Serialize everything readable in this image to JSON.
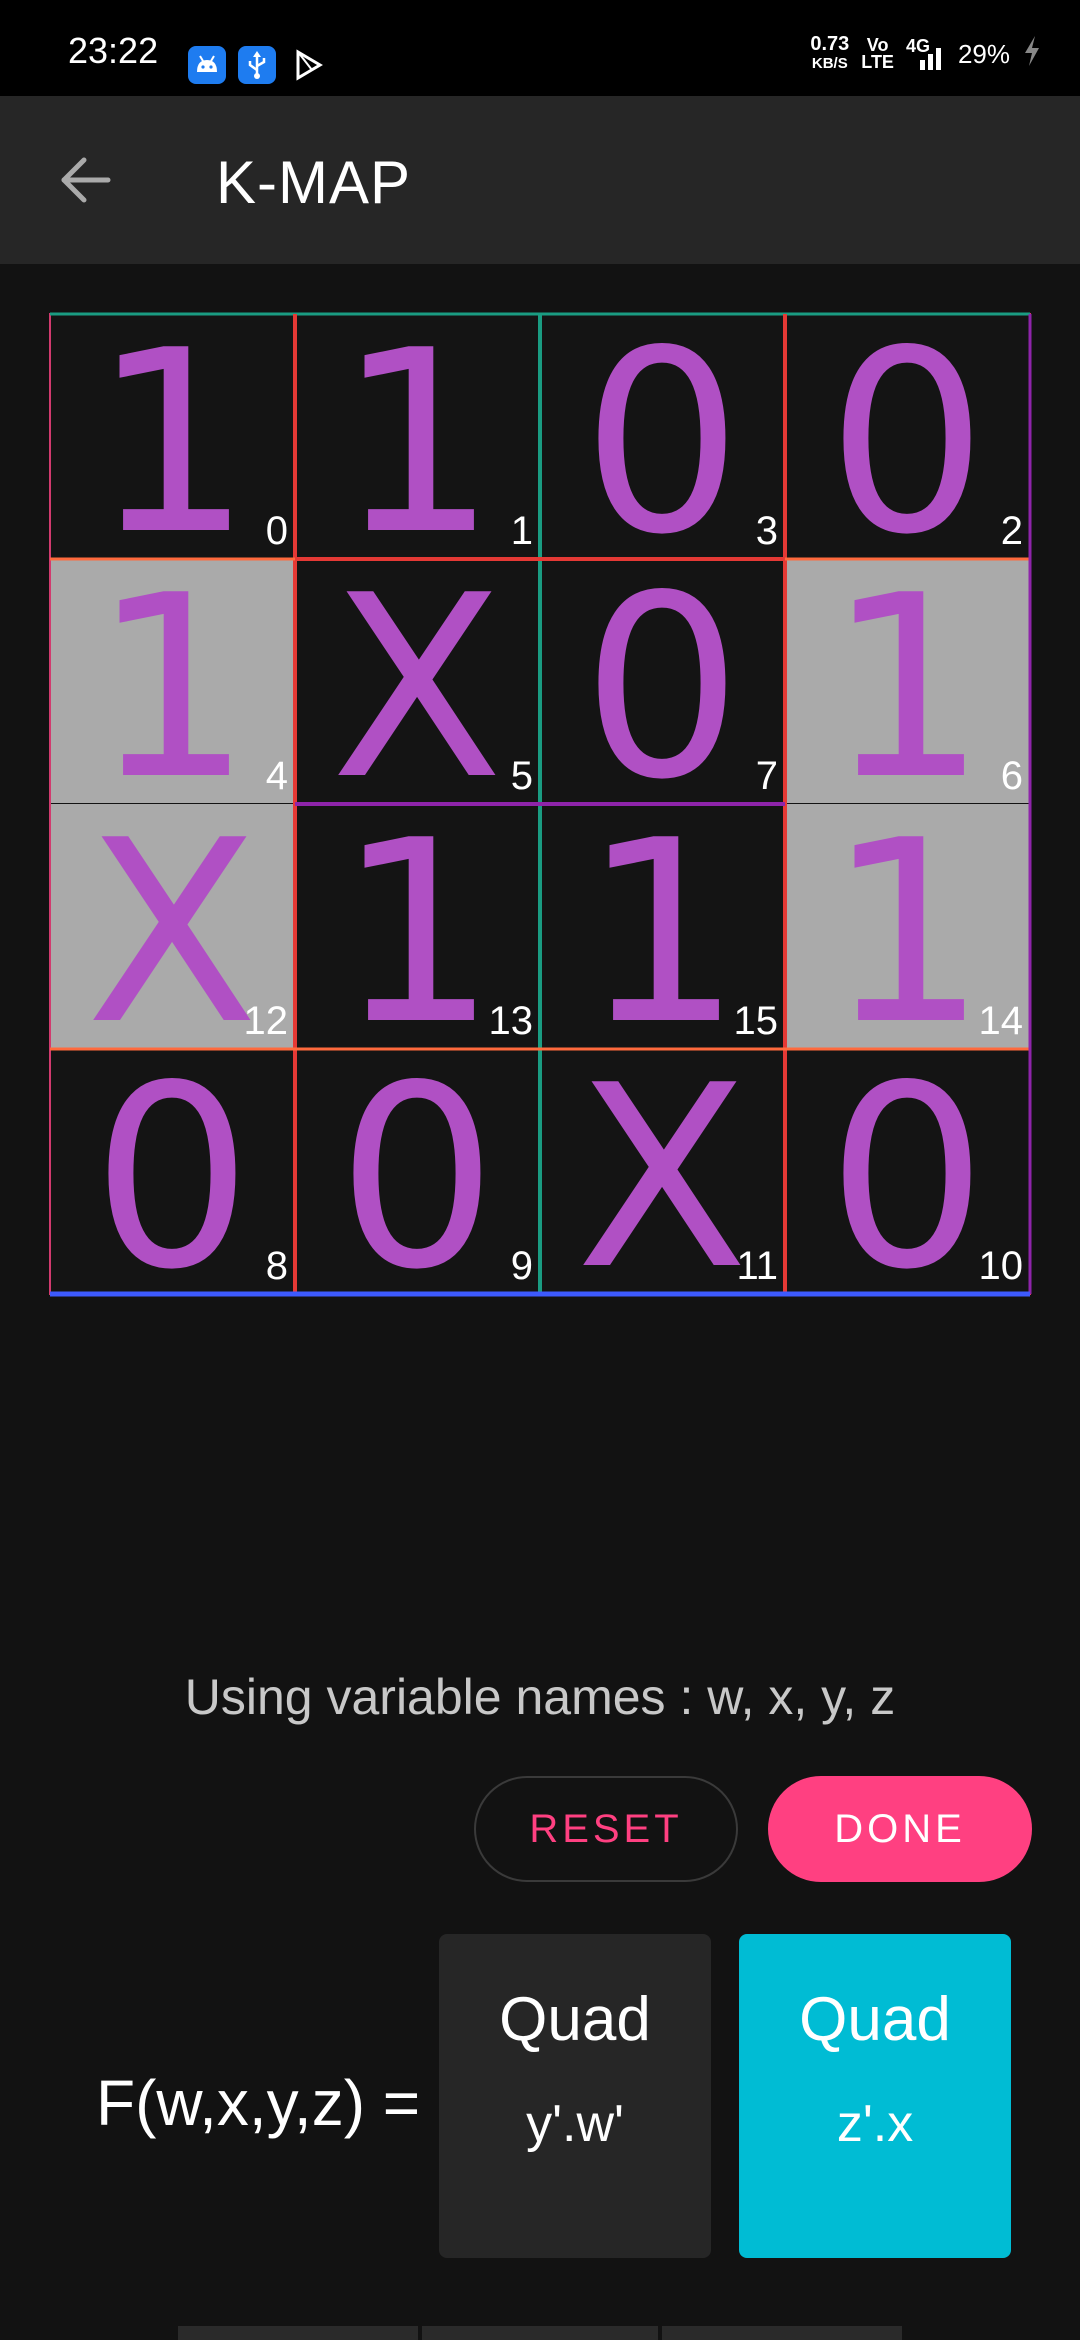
{
  "status_bar": {
    "time": "23:22",
    "speed_value": "0.73",
    "speed_unit": "KB/S",
    "volte_top": "Vo",
    "volte_bottom": "LTE",
    "network": "4G",
    "battery": "29%",
    "icons": [
      "android-icon",
      "usb-icon",
      "play-store-icon",
      "charging-icon"
    ]
  },
  "app_bar": {
    "title": "K-MAP",
    "back_icon": "arrow-left-icon"
  },
  "kmap": {
    "cells": [
      {
        "value": "1",
        "index": "0",
        "highlight": false
      },
      {
        "value": "1",
        "index": "1",
        "highlight": false
      },
      {
        "value": "0",
        "index": "3",
        "highlight": false
      },
      {
        "value": "0",
        "index": "2",
        "highlight": false
      },
      {
        "value": "1",
        "index": "4",
        "highlight": true
      },
      {
        "value": "X",
        "index": "5",
        "highlight": false
      },
      {
        "value": "0",
        "index": "7",
        "highlight": false
      },
      {
        "value": "1",
        "index": "6",
        "highlight": true
      },
      {
        "value": "X",
        "index": "12",
        "highlight": true
      },
      {
        "value": "1",
        "index": "13",
        "highlight": false
      },
      {
        "value": "1",
        "index": "15",
        "highlight": false
      },
      {
        "value": "1",
        "index": "14",
        "highlight": true
      },
      {
        "value": "0",
        "index": "8",
        "highlight": false
      },
      {
        "value": "0",
        "index": "9",
        "highlight": false
      },
      {
        "value": "X",
        "index": "11",
        "highlight": false
      },
      {
        "value": "0",
        "index": "10",
        "highlight": false
      }
    ],
    "colors": {
      "value": "#b050c4",
      "highlight": "#aaaaaa",
      "cell": "#141414"
    }
  },
  "variables_text": "Using variable names : w, x, y, z",
  "buttons": {
    "reset": "RESET",
    "done": "DONE"
  },
  "accent_color": "#ff4081",
  "function_label": "F(w,x,y,z) =",
  "terms": [
    {
      "type": "Quad",
      "expr": "y'.w'",
      "color": "#262626"
    },
    {
      "type": "Quad",
      "expr": "z'.x",
      "color": "#00bcd4"
    }
  ]
}
